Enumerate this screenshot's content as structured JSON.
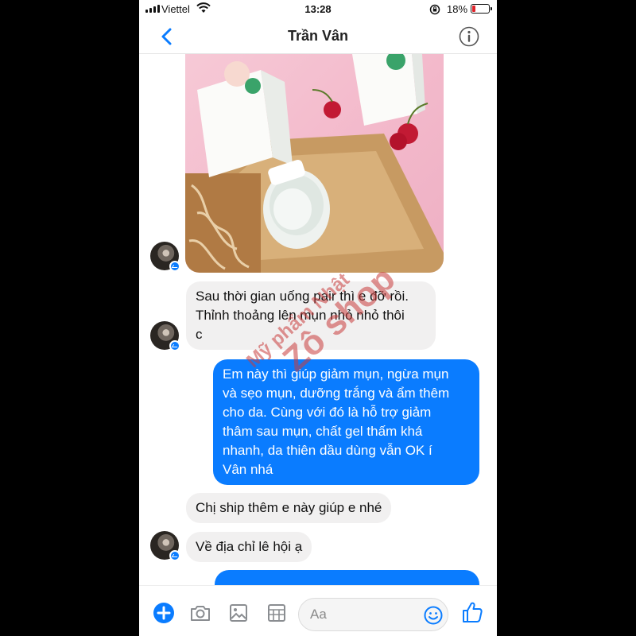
{
  "status_bar": {
    "carrier": "Viettel",
    "time": "13:28",
    "battery_percent": "18%",
    "battery_level": 0.18,
    "icons": [
      "signal-icon",
      "wifi-icon",
      "rotation-lock-icon",
      "battery-icon"
    ]
  },
  "header": {
    "title": "Trần Vân",
    "back_icon": "chevron-left-icon",
    "info_icon": "info-icon"
  },
  "messages": [
    {
      "direction": "incoming",
      "type": "image"
    },
    {
      "direction": "incoming",
      "type": "text",
      "text": "Sau thời gian uống pair thì e đỡ rồi.\nThỉnh thoảng lên mụn nhỏ nhỏ thôi\nc"
    },
    {
      "direction": "outgoing",
      "type": "text",
      "text": "Em này thì giúp giảm mụn, ngừa mụn\nvà sẹo mụn, dưỡng trắng và ẩm thêm\ncho da. Cùng với đó là hỗ trợ giảm\nthâm sau mụn, chất gel thấm khá\nnhanh, da thiên dầu dùng vẫn OK í\nVân nhá"
    },
    {
      "direction": "incoming",
      "type": "text",
      "text": "Chị ship thêm e này giúp e nhé"
    },
    {
      "direction": "incoming",
      "type": "text",
      "text": "Về địa chỉ lê hội ạ"
    },
    {
      "direction": "outgoing",
      "type": "text",
      "text": ""
    }
  ],
  "watermark": {
    "line1": "Mỹ phẩm Nhật",
    "line2": "Zô shop"
  },
  "composer": {
    "placeholder": "Aa",
    "tools": [
      "plus-icon",
      "camera-icon",
      "photo-icon",
      "sticker-grid-icon"
    ],
    "emoji_icon": "emoji-icon",
    "like_icon": "thumbs-up-icon"
  },
  "colors": {
    "accent": "#0a7cff",
    "incoming_bubble": "#f1f0f0",
    "watermark": "#c83c3c",
    "battery_low": "#e0242b"
  }
}
